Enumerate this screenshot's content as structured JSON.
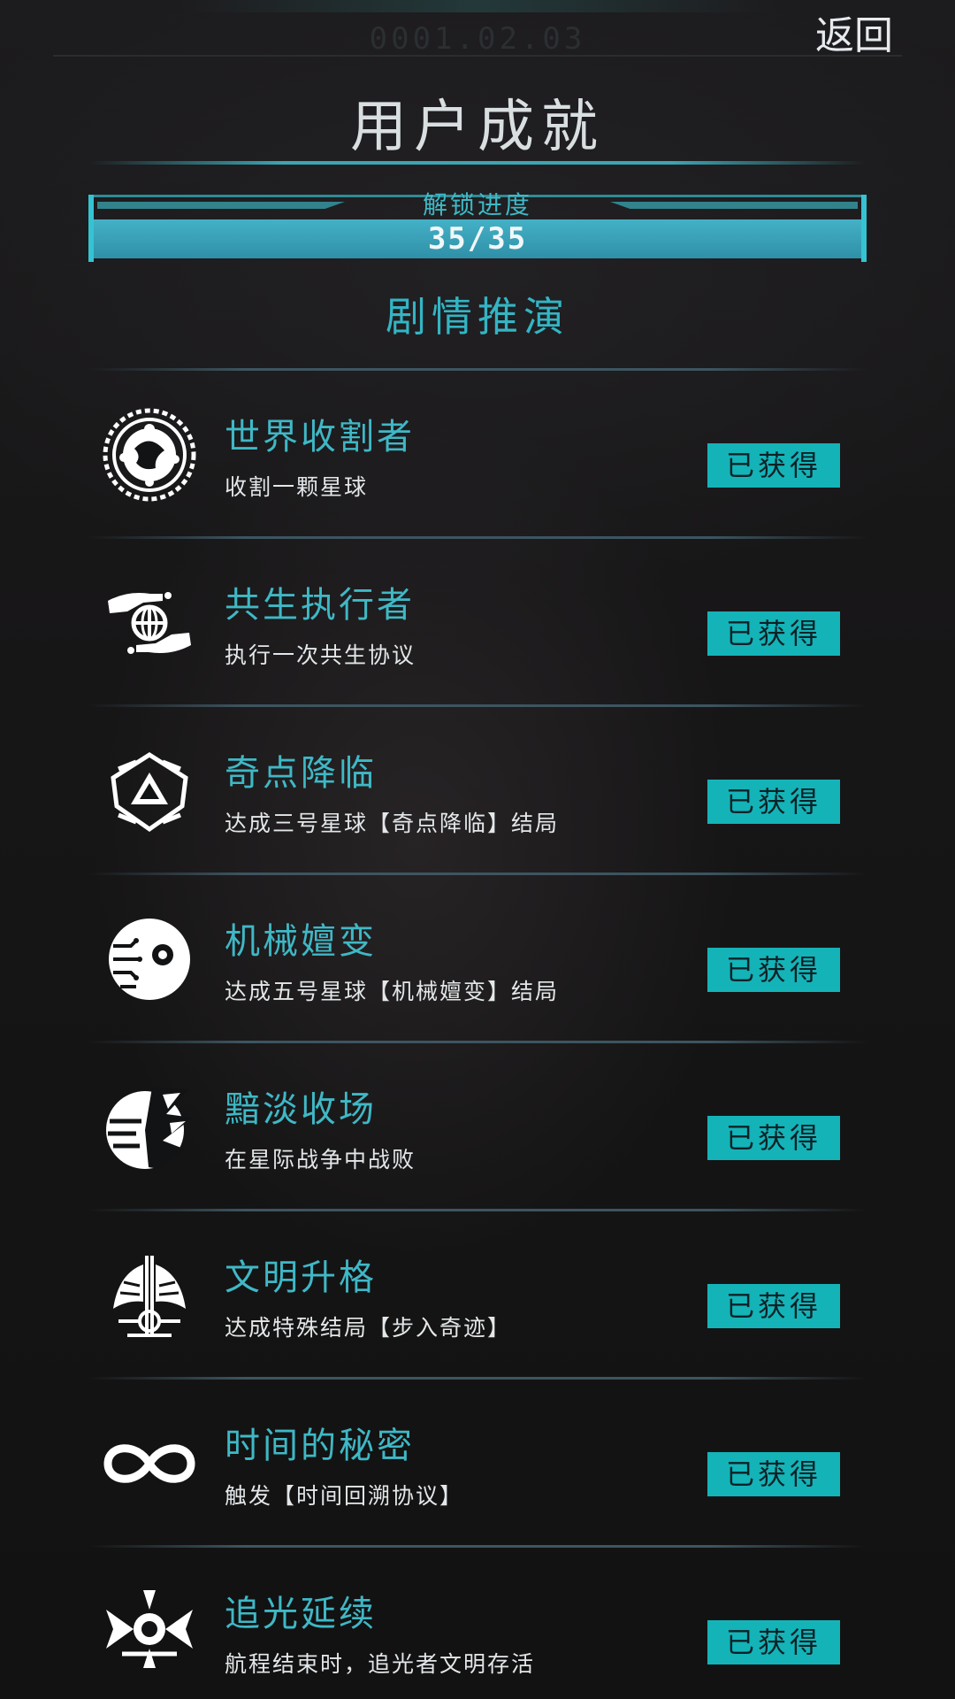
{
  "header": {
    "timestamp": "0001.02.03",
    "back_label": "返回",
    "title": "用户成就"
  },
  "progress": {
    "label": "解锁进度",
    "value_text": "35/35",
    "fraction": 1.0
  },
  "section": {
    "title": "剧情推演"
  },
  "colors": {
    "accent": "#3fb8c6",
    "badge_bg": "#14b3b8",
    "badge_text": "#0c2226"
  },
  "achievements": [
    {
      "icon": "planet-reaper-icon",
      "title": "世界收割者",
      "desc": "收割一颗星球",
      "status": "已获得"
    },
    {
      "icon": "symbiosis-hands-globe-icon",
      "title": "共生执行者",
      "desc": "执行一次共生协议",
      "status": "已获得"
    },
    {
      "icon": "singularity-triangle-icon",
      "title": "奇点降临",
      "desc": "达成三号星球【奇点降临】结局",
      "status": "已获得"
    },
    {
      "icon": "mechanical-eye-icon",
      "title": "机械嬗变",
      "desc": "达成五号星球【机械嬗变】结局",
      "status": "已获得"
    },
    {
      "icon": "shattered-planet-icon",
      "title": "黯淡收场",
      "desc": "在星际战争中战败",
      "status": "已获得"
    },
    {
      "icon": "winged-emblem-icon",
      "title": "文明升格",
      "desc": "达成特殊结局【步入奇迹】",
      "status": "已获得"
    },
    {
      "icon": "infinity-icon",
      "title": "时间的秘密",
      "desc": "触发【时间回溯协议】",
      "status": "已获得"
    },
    {
      "icon": "winged-sun-icon",
      "title": "追光延续",
      "desc": "航程结束时，追光者文明存活",
      "status": "已获得"
    }
  ]
}
